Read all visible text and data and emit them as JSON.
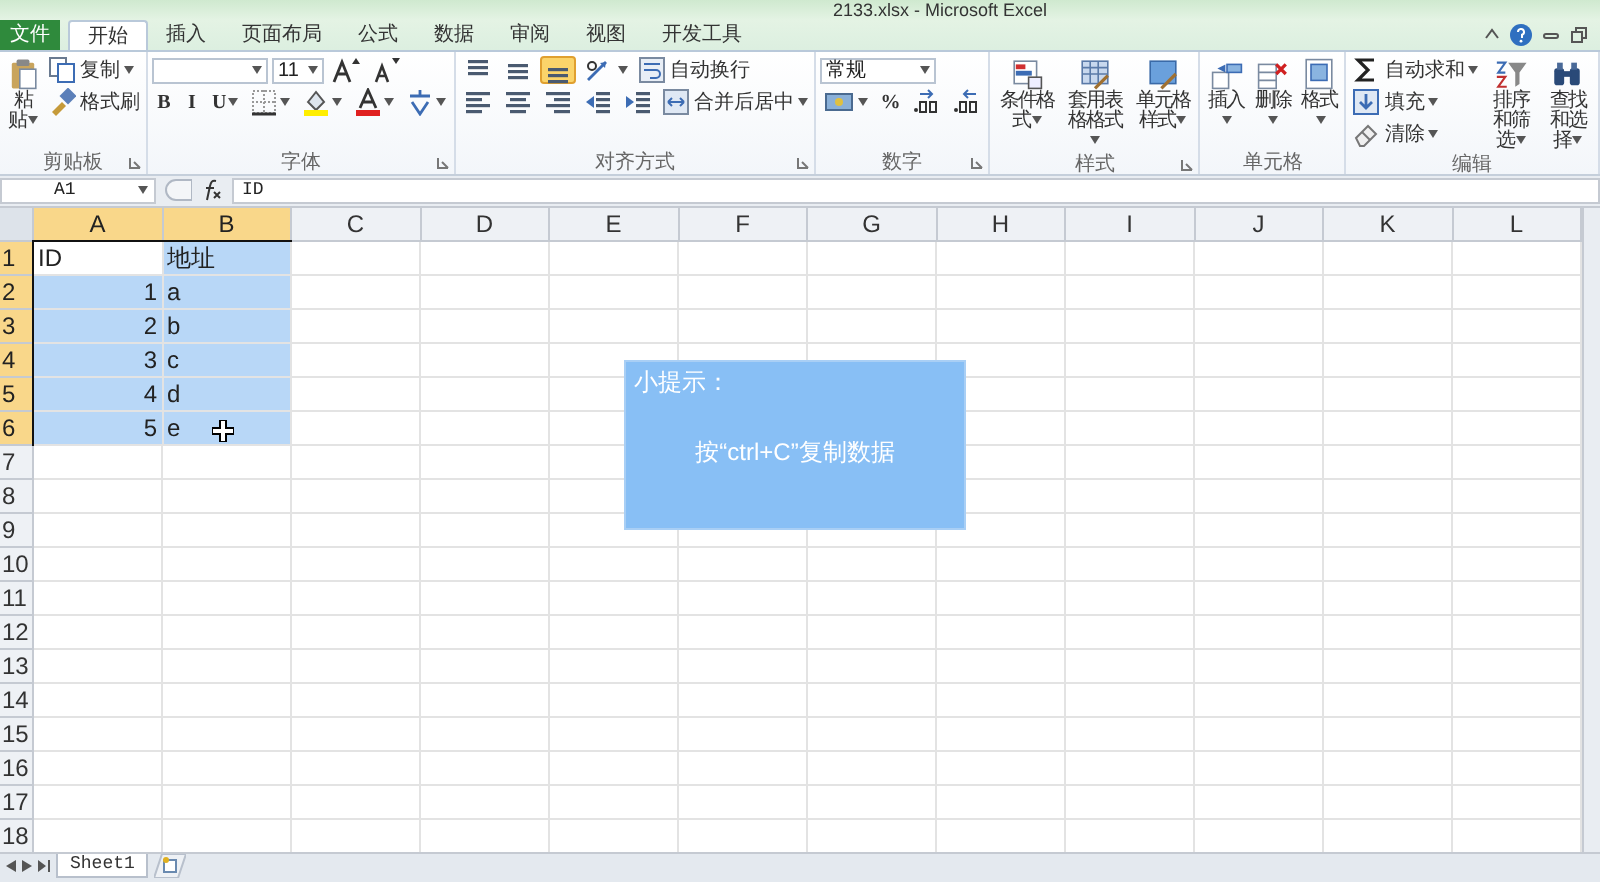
{
  "window": {
    "title": "2133.xlsx - Microsoft Excel"
  },
  "tabs": [
    {
      "label": "文件",
      "kind": "file",
      "selected": false
    },
    {
      "label": "开始",
      "kind": "tab",
      "selected": true
    },
    {
      "label": "插入",
      "kind": "tab",
      "selected": false
    },
    {
      "label": "页面布局",
      "kind": "tab",
      "selected": false
    },
    {
      "label": "公式",
      "kind": "tab",
      "selected": false
    },
    {
      "label": "数据",
      "kind": "tab",
      "selected": false
    },
    {
      "label": "审阅",
      "kind": "tab",
      "selected": false
    },
    {
      "label": "视图",
      "kind": "tab",
      "selected": false
    },
    {
      "label": "开发工具",
      "kind": "tab",
      "selected": false
    }
  ],
  "ribbon": {
    "groups": [
      {
        "label": "剪贴板",
        "launcher": true,
        "sections": [
          {
            "kind": "large",
            "label": "粘贴",
            "dropdown": true
          },
          {
            "kind": "rows",
            "rows": [
              [
                {
                  "kind": "small",
                  "label": "复制",
                  "dropdown": true
                }
              ],
              [
                {
                  "kind": "small",
                  "label": "格式刷",
                  "dropdown": false
                }
              ]
            ]
          }
        ]
      },
      {
        "label": "字体",
        "launcher": true,
        "sections": [
          {
            "kind": "rows",
            "rows": [
              [
                {
                  "kind": "wide-field",
                  "dropdown": true
                },
                {
                  "kind": "narrow-field",
                  "value": "11",
                  "dropdown": true
                },
                {
                  "kind": "icon",
                  "dropdown": false
                },
                {
                  "kind": "icon",
                  "dropdown": false
                }
              ],
              [
                {
                  "kind": "glyph",
                  "label": "B",
                  "dropdown": false
                },
                {
                  "kind": "glyph",
                  "label": "I",
                  "dropdown": false
                },
                {
                  "kind": "glyph",
                  "label": "U",
                  "dropdown": true
                },
                {
                  "kind": "icon",
                  "dropdown": true
                },
                {
                  "kind": "icon",
                  "dropdown": true
                },
                {
                  "kind": "icon",
                  "dropdown": true
                },
                {
                  "kind": "icon",
                  "dropdown": true
                }
              ]
            ]
          }
        ]
      },
      {
        "label": "对齐方式",
        "launcher": true,
        "sections": [
          {
            "kind": "rows",
            "rows": [
              [
                {
                  "kind": "toggle",
                  "selected": false
                },
                {
                  "kind": "toggle",
                  "selected": false
                },
                {
                  "kind": "toggle",
                  "selected": true
                },
                {
                  "kind": "icon",
                  "dropdown": true
                },
                {
                  "kind": "small",
                  "label": "自动换行",
                  "dropdown": false
                }
              ],
              [
                {
                  "kind": "toggle",
                  "selected": false
                },
                {
                  "kind": "toggle",
                  "selected": false
                },
                {
                  "kind": "toggle",
                  "selected": false
                },
                {
                  "kind": "icon",
                  "dropdown": false
                },
                {
                  "kind": "icon",
                  "dropdown": false
                },
                {
                  "kind": "small",
                  "label": "合并后居中",
                  "dropdown": true
                }
              ]
            ]
          }
        ]
      },
      {
        "label": "数字",
        "launcher": true,
        "sections": [
          {
            "kind": "rows",
            "rows": [
              [
                {
                  "kind": "wide-field",
                  "value": "常规",
                  "dropdown": true
                }
              ],
              [
                {
                  "kind": "icon",
                  "dropdown": true
                },
                {
                  "kind": "glyph",
                  "label": "%",
                  "dropdown": false
                },
                {
                  "kind": "icon",
                  "dropdown": false
                },
                {
                  "kind": "icon",
                  "dropdown": false
                }
              ]
            ]
          }
        ]
      },
      {
        "label": "样式",
        "launcher": true,
        "sections": [
          {
            "kind": "large",
            "label": "条件格式",
            "dropdown": true
          },
          {
            "kind": "large",
            "label": "套用表格格式",
            "dropdown": true
          },
          {
            "kind": "large",
            "label": "单元格样式",
            "dropdown": true
          }
        ]
      },
      {
        "label": "单元格",
        "launcher": false,
        "sections": [
          {
            "kind": "large",
            "label": "插入",
            "dropdown": true
          },
          {
            "kind": "large",
            "label": "删除",
            "dropdown": true
          },
          {
            "kind": "large",
            "label": "格式",
            "dropdown": true
          }
        ]
      },
      {
        "label": "编辑",
        "launcher": false,
        "sections": [
          {
            "kind": "rows",
            "rows": [
              [
                {
                  "kind": "small",
                  "label": "自动求和",
                  "dropdown": true
                }
              ],
              [
                {
                  "kind": "small",
                  "label": "填充",
                  "dropdown": true
                }
              ],
              [
                {
                  "kind": "small",
                  "label": "清除",
                  "dropdown": true
                }
              ]
            ]
          },
          {
            "kind": "large",
            "label": "排序和筛选",
            "dropdown": true
          },
          {
            "kind": "large",
            "label": "查找和选择",
            "dropdown": true
          }
        ]
      }
    ]
  },
  "formula_bar": {
    "name_box": "A1",
    "formula": "ID"
  },
  "grid": {
    "columns": [
      {
        "label": "A",
        "selected": true
      },
      {
        "label": "B",
        "selected": true
      },
      {
        "label": "C",
        "selected": false
      },
      {
        "label": "D",
        "selected": false
      },
      {
        "label": "E",
        "selected": false
      },
      {
        "label": "F",
        "selected": false
      },
      {
        "label": "G",
        "selected": false
      },
      {
        "label": "H",
        "selected": false
      },
      {
        "label": "I",
        "selected": false
      },
      {
        "label": "J",
        "selected": false
      },
      {
        "label": "K",
        "selected": false
      },
      {
        "label": "L",
        "selected": false
      }
    ],
    "rows": [
      {
        "header": "1",
        "selected": true,
        "cells": [
          {
            "text": "ID",
            "kind": "text",
            "active": true
          },
          {
            "text": "地址",
            "kind": "text",
            "active": false
          }
        ]
      },
      {
        "header": "2",
        "selected": true,
        "cells": [
          {
            "text": "1",
            "kind": "number",
            "active": false
          },
          {
            "text": "a",
            "kind": "text",
            "active": false
          }
        ]
      },
      {
        "header": "3",
        "selected": true,
        "cells": [
          {
            "text": "2",
            "kind": "number",
            "active": false
          },
          {
            "text": "b",
            "kind": "text",
            "active": false
          }
        ]
      },
      {
        "header": "4",
        "selected": true,
        "cells": [
          {
            "text": "3",
            "kind": "number",
            "active": false
          },
          {
            "text": "c",
            "kind": "text",
            "active": false
          }
        ]
      },
      {
        "header": "5",
        "selected": true,
        "cells": [
          {
            "text": "4",
            "kind": "number",
            "active": false
          },
          {
            "text": "d",
            "kind": "text",
            "active": false
          }
        ]
      },
      {
        "header": "6",
        "selected": true,
        "cells": [
          {
            "text": "5",
            "kind": "number",
            "active": false
          },
          {
            "text": "e",
            "kind": "text",
            "active": false
          }
        ]
      },
      {
        "header": "7",
        "selected": false
      },
      {
        "header": "8",
        "selected": false
      },
      {
        "header": "9",
        "selected": false
      },
      {
        "header": "10",
        "selected": false
      },
      {
        "header": "11",
        "selected": false
      },
      {
        "header": "12",
        "selected": false
      },
      {
        "header": "13",
        "selected": false
      },
      {
        "header": "14",
        "selected": false
      },
      {
        "header": "15",
        "selected": false
      },
      {
        "header": "16",
        "selected": false
      },
      {
        "header": "17",
        "selected": false
      },
      {
        "header": "18",
        "selected": false
      }
    ]
  },
  "tip": {
    "title": "小提示：",
    "text": "按“ctrl+C”复制数据"
  },
  "sheet_tabs": [
    {
      "label": "Sheet1",
      "selected": true
    }
  ]
}
